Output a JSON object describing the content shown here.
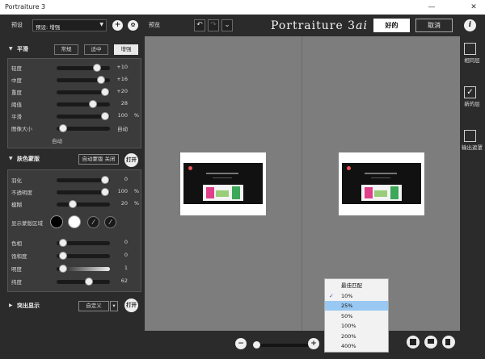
{
  "window": {
    "title": "Portraiture 3",
    "minimize": "—",
    "maximize": "☐",
    "close": "✕"
  },
  "toolbar": {
    "preset_label": "预设",
    "preset_value": "预设: 增强",
    "add_icon": "+",
    "settings_icon": "✿",
    "preview_label": "预览",
    "undo_icon": "↶",
    "redo_icon": "↷",
    "history_icon": "⌄",
    "brand_main": "Portraiture 3",
    "brand_ai": "ai",
    "ok_label": "好的",
    "cancel_label": "取消",
    "info_icon": "i"
  },
  "smoothing": {
    "title": "平滑",
    "modes": [
      "常规",
      "适中",
      "增强"
    ],
    "active_mode": "增强",
    "sliders": [
      {
        "label": "轻度",
        "value": "+10",
        "unit": "",
        "pos": 0.81
      },
      {
        "label": "中度",
        "value": "+16",
        "unit": "",
        "pos": 0.9
      },
      {
        "label": "重度",
        "value": "+20",
        "unit": "",
        "pos": 0.98
      },
      {
        "label": "阈值",
        "value": "28",
        "unit": "",
        "pos": 0.72
      },
      {
        "label": "平滑",
        "value": "100",
        "unit": "%",
        "pos": 0.98
      }
    ],
    "image_size": {
      "label": "图像大小",
      "value": "自动",
      "sub": "自动",
      "pos": 0.05
    }
  },
  "skin_mask": {
    "title": "肤色蒙版",
    "auto_mask_label": "自动蒙版 关闭",
    "toggle_label": "打开",
    "sliders": [
      {
        "label": "羽化",
        "value": "0",
        "unit": "",
        "pos": 0.98
      },
      {
        "label": "不透明度",
        "value": "100",
        "unit": "%",
        "pos": 0.98
      },
      {
        "label": "模糊",
        "value": "20",
        "unit": "%",
        "pos": 0.26
      }
    ],
    "show_mask_label": "显示蒙版区域",
    "color_black": "#000000",
    "color_white": "#ffffff",
    "picker_icon": "eyedropper-icon",
    "picker_plus_icon": "eyedropper-plus-icon",
    "color_sliders": [
      {
        "label": "色相",
        "value": "0",
        "pos": 0.05,
        "gradient": false
      },
      {
        "label": "饱和度",
        "value": "0",
        "pos": 0.05,
        "gradient": false
      },
      {
        "label": "明度",
        "value": "1",
        "pos": 0.05,
        "gradient": true
      },
      {
        "label": "纬度",
        "value": "62",
        "pos": 0.62,
        "gradient": false
      }
    ]
  },
  "enhance": {
    "title": "突出显示",
    "custom_label": "自定义",
    "toggle_label": "打开"
  },
  "zoom_menu": {
    "items": [
      "最佳匹配",
      "10%",
      "25%",
      "50%",
      "100%",
      "200%",
      "400%"
    ],
    "checked": "10%",
    "highlighted": "25%"
  },
  "zoom": {
    "minus_icon": "−",
    "plus_icon": "+"
  },
  "layers": {
    "items": [
      {
        "label": "相同层",
        "checked": false
      },
      {
        "label": "新的层",
        "checked": true
      },
      {
        "label": "输出遮罩",
        "checked": false
      }
    ],
    "check_glyph": "✓"
  }
}
